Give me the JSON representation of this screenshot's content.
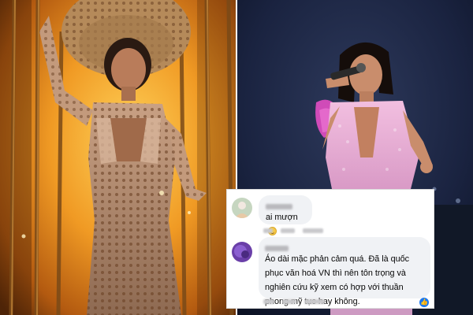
{
  "comments": [
    {
      "author": "",
      "text": "ai mượn",
      "emoji": "smiling-face-emoji"
    },
    {
      "author": "",
      "text": "Áo dài mặc phản cảm quá. Đã là quốc phục văn hoá VN thì nên tôn trọng và nghiên cứu kỹ xem có hợp với thuần phong mỹ tục hay không.",
      "reaction": "like-reaction-icon"
    }
  ],
  "colors": {
    "bubble": "#f0f2f5",
    "like_blue": "#1877f2",
    "stage_blue": "#1e2a48",
    "fire_orange": "#e8891a"
  }
}
